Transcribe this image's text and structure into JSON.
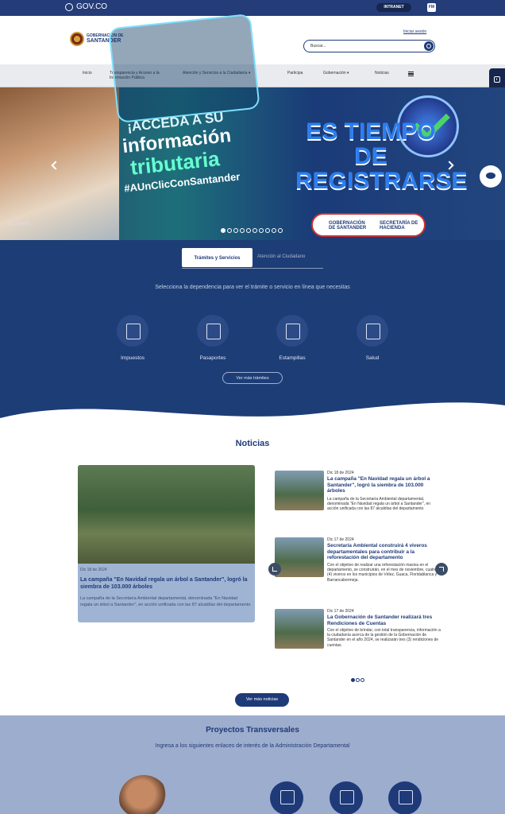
{
  "gov_bar": {
    "logo_text": "GOV.CO",
    "intranet": "INTRANET",
    "fm": "FM"
  },
  "header": {
    "logo_line1": "GOBERNACIÓN DE",
    "logo_line2": "SANTANDER",
    "login": "Iniciar sesión",
    "search_placeholder": "Buscar..."
  },
  "nav": {
    "items": [
      {
        "label": "Inicio"
      },
      {
        "label": "Transparencia y Acceso a la Información Pública"
      },
      {
        "label": "Atención y Servicios a la Ciudadanía ▾"
      },
      {
        "label": "Participa"
      },
      {
        "label": "Gobernación ▾"
      },
      {
        "label": "Noticias"
      }
    ]
  },
  "hero": {
    "line1": "¡ACCEDA A SU",
    "line2": "información",
    "line3": "tributaria",
    "line4": "#AUnClicConSantander",
    "tiempo": "ES TIEMPO DE REGISTRARSE",
    "logo_left": "GOBERNACIÓN DE SANTANDER",
    "logo_right": "SECRETARÍA DE HACIENDA",
    "pause": "Detener",
    "slides": 10,
    "active_slide": 1
  },
  "tramites": {
    "tab_active": "Trámites y Servicios",
    "tab_other": "Atención al Ciudadano",
    "intro": "Selecciona la dependencia para ver el trámite o servicio en línea que necesitas",
    "services": [
      {
        "label": "Impuestos",
        "icon": "receipt-icon"
      },
      {
        "label": "Pasaportes",
        "icon": "passport-icon"
      },
      {
        "label": "Estampillas",
        "icon": "building-icon"
      },
      {
        "label": "Salud",
        "icon": "health-icon"
      }
    ],
    "more": "Ver más trámites"
  },
  "news": {
    "title": "Noticias",
    "featured": {
      "date": "Dic 18 de 2024",
      "title": "La campaña \"En Navidad regala un árbol a Santander\", logró la siembra de 103.000 árboles",
      "summary": "La campaña de la Secretaría Ambiental departamental, denominada \"En Navidad regala un árbol a Santander\", en acción unificada con las 87 alcaldías del departamento"
    },
    "items": [
      {
        "date": "Dic 18 de 2024",
        "title": "La campaña \"En Navidad regala un árbol a Santander\", logró la siembra de 103.000 árboles",
        "summary": "La campaña de la Secretaría Ambiental departamental, denominada \"En Navidad regala un árbol a Santander\", en acción unificada con las 87 alcaldías del departamento"
      },
      {
        "date": "Dic 17 de 2024",
        "title": "Secretaría Ambiental construirá 4 viveros departamentales para contribuir a la reforestación del departamento",
        "summary": "Con el objetivo de realizar una reforestación masiva en el departamento, se construirán, en el mes de noviembre, cuatro (4) viveros en los municipios de Vélez, Guaca, Floridablanca y Barrancabermeja."
      },
      {
        "date": "Dic 17 de 2024",
        "title": "La Gobernación de Santander realizará tres Rendiciones de Cuentas",
        "summary": "Con el objetivo de brindar, con total transparencia, información a la ciudadanía acerca de la gestión de la Gobernación de Santander en el año 2024, se realizarán tres (3) rendiciones de cuentas."
      }
    ],
    "pages": 3,
    "active_page": 1,
    "more": "Ver más noticias"
  },
  "projects": {
    "title": "Proyectos Transversales",
    "subtitle": "Ingresa a los siguientes enlaces de interés de la Administración Departamental"
  }
}
